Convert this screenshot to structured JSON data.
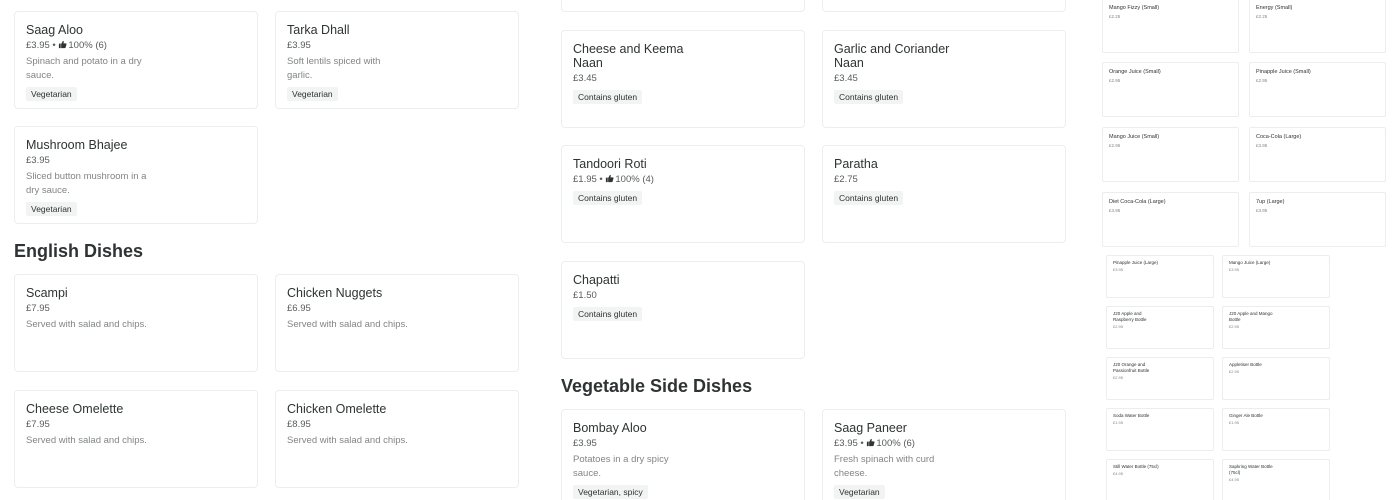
{
  "col1": {
    "vegetarian_cards": [
      {
        "name": "Saag Aloo",
        "price": "£3.95 • ",
        "rating": "100% (6)",
        "desc": "Spinach and potato in a dry sauce.",
        "tag": "Vegetarian"
      },
      {
        "name": "Tarka Dhall",
        "price": "£3.95",
        "rating": "",
        "desc": "Soft lentils spiced with garlic.",
        "tag": "Vegetarian"
      },
      {
        "name": "Mushroom Bhajee",
        "price": "£3.95",
        "rating": "",
        "desc": "Sliced button mushroom in a dry sauce.",
        "tag": "Vegetarian"
      }
    ],
    "english_title": "English Dishes",
    "english_cards": [
      {
        "name": "Scampi",
        "price": "£7.95",
        "desc": "Served with salad and chips."
      },
      {
        "name": "Chicken Nuggets",
        "price": "£6.95",
        "desc": "Served with salad and chips."
      },
      {
        "name": "Cheese Omelette",
        "price": "£7.95",
        "desc": "Served with salad and chips."
      },
      {
        "name": "Chicken Omelette",
        "price": "£8.95",
        "desc": "Served with salad and chips."
      }
    ]
  },
  "col2": {
    "bread_cards": [
      {
        "name": "Cheese and Keema Naan",
        "price": "£3.45",
        "rating": "",
        "tag": "Contains gluten"
      },
      {
        "name": "Garlic and Coriander Naan",
        "price": "£3.45",
        "rating": "",
        "tag": "Contains gluten"
      },
      {
        "name": "Tandoori Roti",
        "price": "£1.95 • ",
        "rating": "100% (4)",
        "tag": "Contains gluten"
      },
      {
        "name": "Paratha",
        "price": "£2.75",
        "rating": "",
        "tag": "Contains gluten"
      },
      {
        "name": "Chapatti",
        "price": "£1.50",
        "rating": "",
        "tag": "Contains gluten"
      }
    ],
    "veg_side_title": "Vegetable Side Dishes",
    "veg_side_cards": [
      {
        "name": "Bombay Aloo",
        "price": "£3.95",
        "rating": "",
        "desc": "Potatoes in a dry spicy sauce.",
        "tag": "Vegetarian, spicy"
      },
      {
        "name": "Saag Paneer",
        "price": "£3.95 • ",
        "rating": "100% (6)",
        "desc": "Fresh spinach with curd cheese.",
        "tag": "Vegetarian"
      }
    ]
  },
  "drinks": [
    {
      "name": "Mango Fizzy (Small)",
      "price": "£2.25"
    },
    {
      "name": "Energy (Small)",
      "price": "£2.25"
    },
    {
      "name": "Orange Juice (Small)",
      "price": "£2.95"
    },
    {
      "name": "Pinapple Juice (Small)",
      "price": "£2.95"
    },
    {
      "name": "Mango Juice (Small)",
      "price": "£2.95"
    },
    {
      "name": "Coca-Cola (Large)",
      "price": "£3.95"
    },
    {
      "name": "Diet Coca-Cola (Large)",
      "price": "£3.95"
    },
    {
      "name": "7up (Large)",
      "price": "£3.95"
    },
    {
      "name": "Pinapple Juice (Large)",
      "price": "£3.95"
    },
    {
      "name": "Mango Juice (Large)",
      "price": "£3.95"
    },
    {
      "name": "J20 Apple and Raspberry Bottle",
      "price": "£2.95"
    },
    {
      "name": "J20 Apple and Mango Bottle",
      "price": "£2.95"
    },
    {
      "name": "J20 Orange and Passionfruit Bottle",
      "price": "£2.95"
    },
    {
      "name": "Appletiser Bottle",
      "price": "£2.95"
    },
    {
      "name": "Soda Water Bottle",
      "price": "£1.95"
    },
    {
      "name": "Ginger Ale Bottle",
      "price": "£1.95"
    },
    {
      "name": "Still Water Bottle (75cl)",
      "price": "£4.95"
    },
    {
      "name": "Sapkring Water Bottle (75cl)",
      "price": "£4.95"
    }
  ],
  "colors": {
    "rating_icon": "#2e3333",
    "border": "#eceeee",
    "tag_bg": "#f2f3f3"
  }
}
